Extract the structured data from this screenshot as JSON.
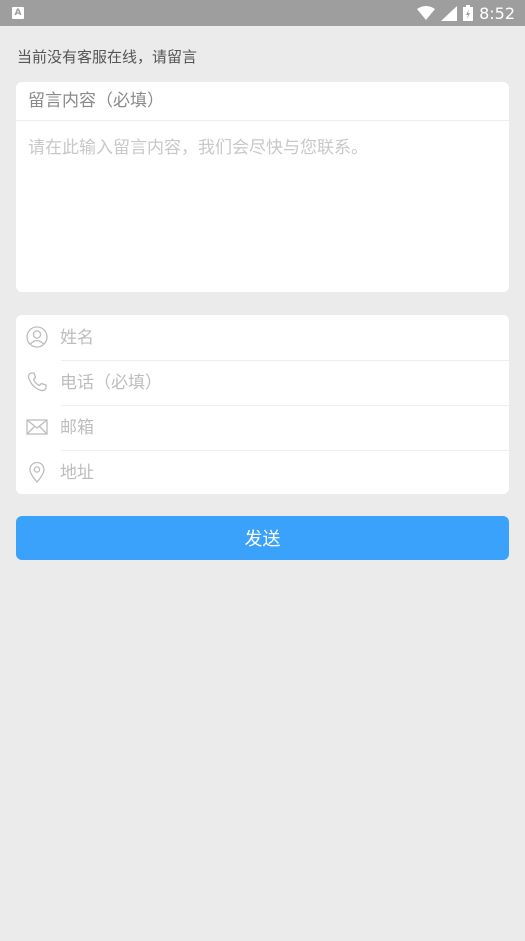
{
  "status_bar": {
    "left_icon_label": "A",
    "time": "8:52",
    "icons": [
      "wifi-icon",
      "signal-icon",
      "battery-icon"
    ]
  },
  "notice": "当前没有客服在线，请留言",
  "message": {
    "label": "留言内容（必填）",
    "placeholder": "请在此输入留言内容，我们会尽快与您联系。"
  },
  "contact_fields": [
    {
      "icon": "person-icon",
      "placeholder": "姓名"
    },
    {
      "icon": "phone-icon",
      "placeholder": "电话（必填）"
    },
    {
      "icon": "mail-icon",
      "placeholder": "邮箱"
    },
    {
      "icon": "location-icon",
      "placeholder": "地址"
    }
  ],
  "send_button": {
    "label": "发送",
    "color": "#3aa2fb"
  },
  "colors": {
    "background": "#ebebeb",
    "status_bar": "#9e9e9e",
    "placeholder": "#bdbdbd"
  }
}
